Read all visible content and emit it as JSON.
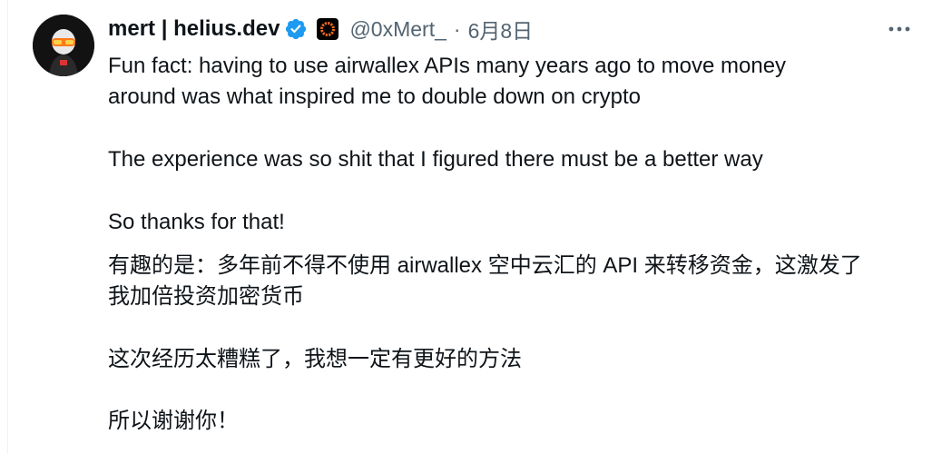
{
  "tweet": {
    "author": {
      "display_name": "mert | helius.dev",
      "handle": "@0xMert_",
      "verified_icon": "verified-badge-icon",
      "affiliate_icon": "helius-logo-icon",
      "avatar_icon": "avatar-image"
    },
    "separator": "·",
    "date": "6月8日",
    "more_icon": "more-dots-icon",
    "text": {
      "p1_line1": "Fun fact: having to use airwallex APIs many years ago to move money",
      "p1_line2": "around was what inspired me to double down on crypto",
      "p2": "The experience was so shit that I figured there must be a better way",
      "p3": "So thanks for that!"
    },
    "translation": {
      "p1_line1": "有趣的是：多年前不得不使用 airwallex 空中云汇的 API 来转移资金，这激发了",
      "p1_line2": "我加倍投资加密货币",
      "p2": "这次经历太糟糕了，我想一定有更好的方法",
      "p3": "所以谢谢你！"
    },
    "colors": {
      "text": "#0f1419",
      "secondary": "#536471",
      "verified_blue": "#1d9bf0"
    }
  }
}
